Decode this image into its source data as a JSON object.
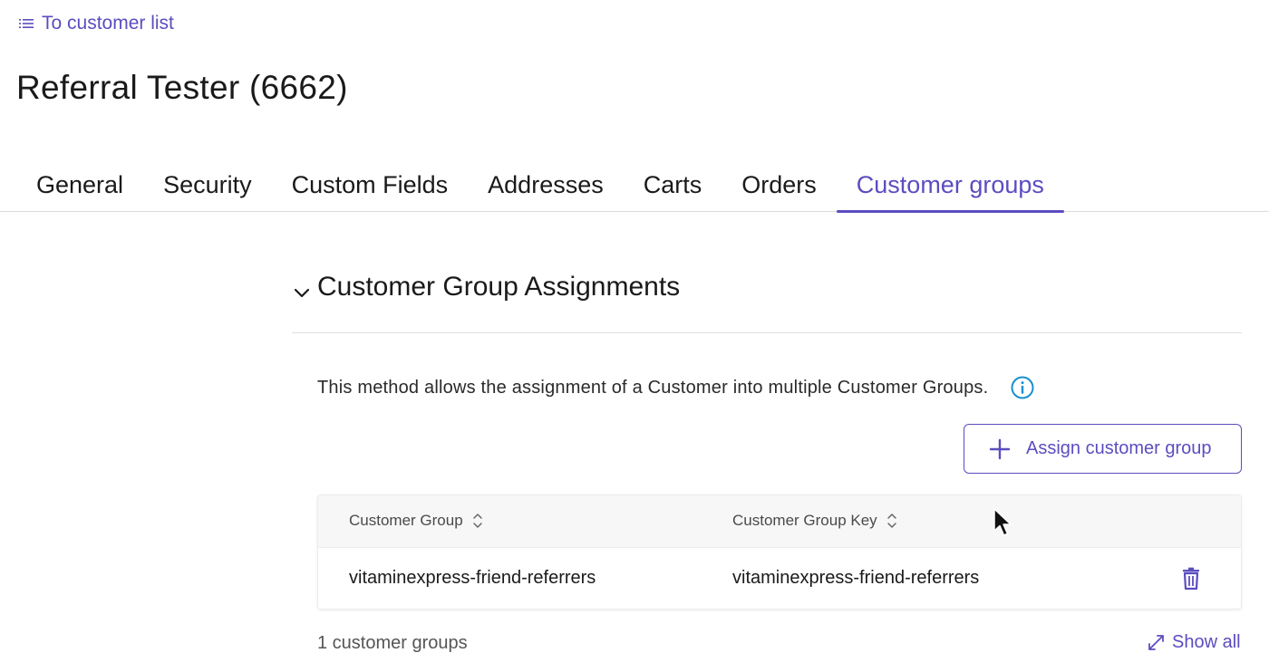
{
  "nav": {
    "back_label": "To customer list",
    "back_icon": "list-icon"
  },
  "customer": {
    "title": "Referral Tester (6662)"
  },
  "tabs": [
    {
      "label": "General",
      "active": false
    },
    {
      "label": "Security",
      "active": false
    },
    {
      "label": "Custom Fields",
      "active": false
    },
    {
      "label": "Addresses",
      "active": false
    },
    {
      "label": "Carts",
      "active": false
    },
    {
      "label": "Orders",
      "active": false
    },
    {
      "label": "Customer groups",
      "active": true
    }
  ],
  "section": {
    "title": "Customer Group Assignments",
    "description": "This method allows the assignment of a Customer into multiple Customer Groups.",
    "assign_button_label": "Assign customer group"
  },
  "table": {
    "columns": [
      "Customer Group",
      "Customer Group Key"
    ],
    "rows": [
      {
        "group": "vitaminexpress-friend-referrers",
        "key": "vitaminexpress-friend-referrers"
      }
    ]
  },
  "footer": {
    "count_label": "1 customer groups",
    "show_all_label": "Show all"
  },
  "colors": {
    "accent": "#5b4dbf",
    "info": "#1a8fcf",
    "text": "#1a1a1a",
    "border": "#dcdcdc"
  }
}
